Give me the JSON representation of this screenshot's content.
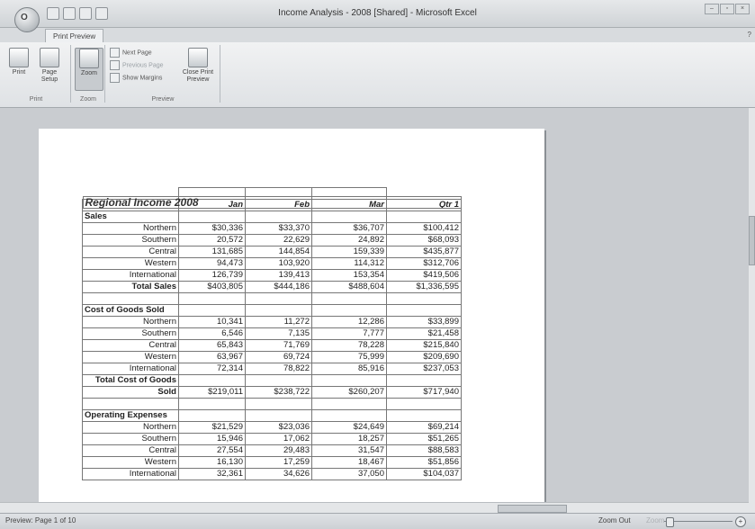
{
  "window": {
    "title": "Income Analysis - 2008  [Shared] - Microsoft Excel",
    "office_button": "O",
    "window_controls": [
      "–",
      "▫",
      "×"
    ],
    "help_text": "?"
  },
  "tabs": [
    "Print Preview"
  ],
  "ribbon": {
    "print_group": {
      "label": "Print",
      "buttons": [
        "Print",
        "Page Setup"
      ]
    },
    "zoom_group": {
      "label": "Zoom",
      "buttons": [
        "Zoom"
      ]
    },
    "preview_group": {
      "label": "Preview",
      "next_page": "Next Page",
      "previous_page": "Previous Page",
      "show_margins": "Show Margins",
      "close_preview": "Close Print Preview"
    }
  },
  "spreadsheet": {
    "title": "Regional Income 2008",
    "headers": [
      "",
      "Jan",
      "Feb",
      "Mar",
      "Qtr 1"
    ],
    "rows": [
      {
        "type": "section",
        "cells": [
          "Sales",
          "",
          "",
          "",
          ""
        ]
      },
      {
        "type": "data",
        "cells": [
          "Northern",
          "$30,336",
          "$33,370",
          "$36,707",
          "$100,412"
        ]
      },
      {
        "type": "data",
        "cells": [
          "Southern",
          "20,572",
          "22,629",
          "24,892",
          "$68,093"
        ]
      },
      {
        "type": "data",
        "cells": [
          "Central",
          "131,685",
          "144,854",
          "159,339",
          "$435,877"
        ]
      },
      {
        "type": "data",
        "cells": [
          "Western",
          "94,473",
          "103,920",
          "114,312",
          "$312,706"
        ]
      },
      {
        "type": "data",
        "cells": [
          "International",
          "126,739",
          "139,413",
          "153,354",
          "$419,506"
        ]
      },
      {
        "type": "total",
        "cells": [
          "Total Sales",
          "$403,805",
          "$444,186",
          "$488,604",
          "$1,336,595"
        ]
      },
      {
        "type": "blank",
        "cells": [
          "",
          "",
          "",
          "",
          ""
        ]
      },
      {
        "type": "section",
        "cells": [
          "Cost of Goods Sold",
          "",
          "",
          "",
          ""
        ]
      },
      {
        "type": "data",
        "cells": [
          "Northern",
          "10,341",
          "11,272",
          "12,286",
          "$33,899"
        ]
      },
      {
        "type": "data",
        "cells": [
          "Southern",
          "6,546",
          "7,135",
          "7,777",
          "$21,458"
        ]
      },
      {
        "type": "data",
        "cells": [
          "Central",
          "65,843",
          "71,769",
          "78,228",
          "$215,840"
        ]
      },
      {
        "type": "data",
        "cells": [
          "Western",
          "63,967",
          "69,724",
          "75,999",
          "$209,690"
        ]
      },
      {
        "type": "data",
        "cells": [
          "International",
          "72,314",
          "78,822",
          "85,916",
          "$237,053"
        ]
      },
      {
        "type": "total",
        "cells": [
          "Total Cost of Goods",
          "",
          "",
          "",
          ""
        ]
      },
      {
        "type": "total",
        "cells": [
          "Sold",
          "$219,011",
          "$238,722",
          "$260,207",
          "$717,940"
        ]
      },
      {
        "type": "blank",
        "cells": [
          "",
          "",
          "",
          "",
          ""
        ]
      },
      {
        "type": "section",
        "cells": [
          "Operating Expenses",
          "",
          "",
          "",
          ""
        ]
      },
      {
        "type": "data",
        "cells": [
          "Northern",
          "$21,529",
          "$23,036",
          "$24,649",
          "$69,214"
        ]
      },
      {
        "type": "data",
        "cells": [
          "Southern",
          "15,946",
          "17,062",
          "18,257",
          "$51,265"
        ]
      },
      {
        "type": "data",
        "cells": [
          "Central",
          "27,554",
          "29,483",
          "31,547",
          "$88,583"
        ]
      },
      {
        "type": "data",
        "cells": [
          "Western",
          "16,130",
          "17,259",
          "18,467",
          "$51,856"
        ]
      },
      {
        "type": "data",
        "cells": [
          "International",
          "32,361",
          "34,626",
          "37,050",
          "$104,037"
        ]
      }
    ]
  },
  "status": {
    "page_info": "Preview: Page 1 of 10",
    "zoom_out": "Zoom Out",
    "zoom_in": "Zoom In",
    "zoom_plus": "+"
  }
}
